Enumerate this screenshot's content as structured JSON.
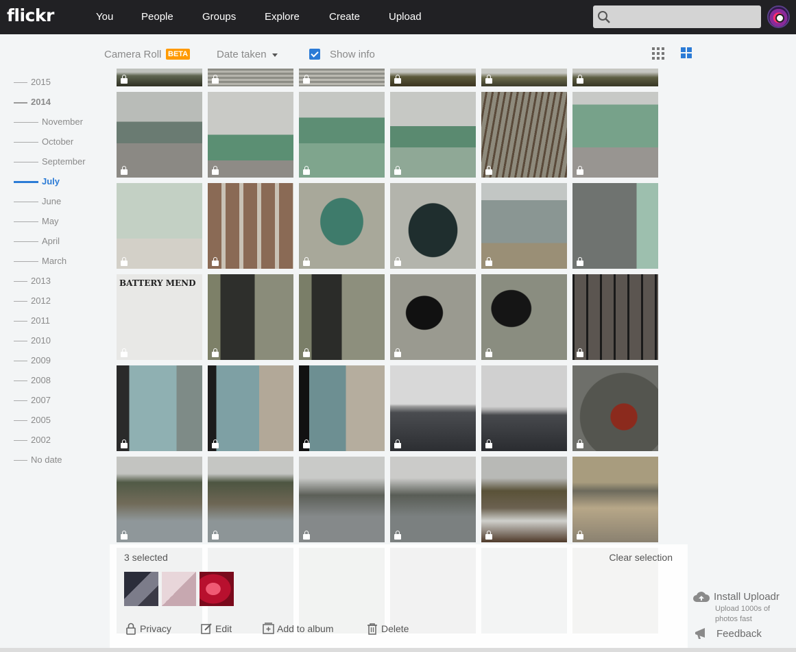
{
  "brand": {
    "logo": "flickr"
  },
  "nav": {
    "items": [
      "You",
      "People",
      "Groups",
      "Explore",
      "Create",
      "Upload"
    ]
  },
  "toolbar": {
    "camera_roll": "Camera Roll",
    "beta": "BETA",
    "sort": "Date taken",
    "show_info": "Show info",
    "show_info_checked": true,
    "accent": "#2b7bd6",
    "beta_color": "#ff9a00"
  },
  "timeline": {
    "items": [
      {
        "label": "2015",
        "level": "year"
      },
      {
        "label": "2014",
        "level": "year",
        "state": "expanded"
      },
      {
        "label": "November",
        "level": "month"
      },
      {
        "label": "October",
        "level": "month"
      },
      {
        "label": "September",
        "level": "month"
      },
      {
        "label": "July",
        "level": "month",
        "state": "active"
      },
      {
        "label": "June",
        "level": "month"
      },
      {
        "label": "May",
        "level": "month"
      },
      {
        "label": "April",
        "level": "month"
      },
      {
        "label": "March",
        "level": "month"
      },
      {
        "label": "2013",
        "level": "year"
      },
      {
        "label": "2012",
        "level": "year"
      },
      {
        "label": "2011",
        "level": "year"
      },
      {
        "label": "2010",
        "level": "year"
      },
      {
        "label": "2009",
        "level": "year"
      },
      {
        "label": "2008",
        "level": "year"
      },
      {
        "label": "2007",
        "level": "year"
      },
      {
        "label": "2005",
        "level": "year"
      },
      {
        "label": "2002",
        "level": "year"
      },
      {
        "label": "No date",
        "level": "year"
      }
    ]
  },
  "sign_text": "BATTERY MEND",
  "selection": {
    "count_text": "3 selected",
    "clear": "Clear selection",
    "actions": [
      "Privacy",
      "Edit",
      "Add to album",
      "Delete"
    ]
  },
  "uploadr": {
    "title": "Install Uploadr",
    "subtitle": "Upload 1000s of photos fast",
    "feedback": "Feedback"
  }
}
